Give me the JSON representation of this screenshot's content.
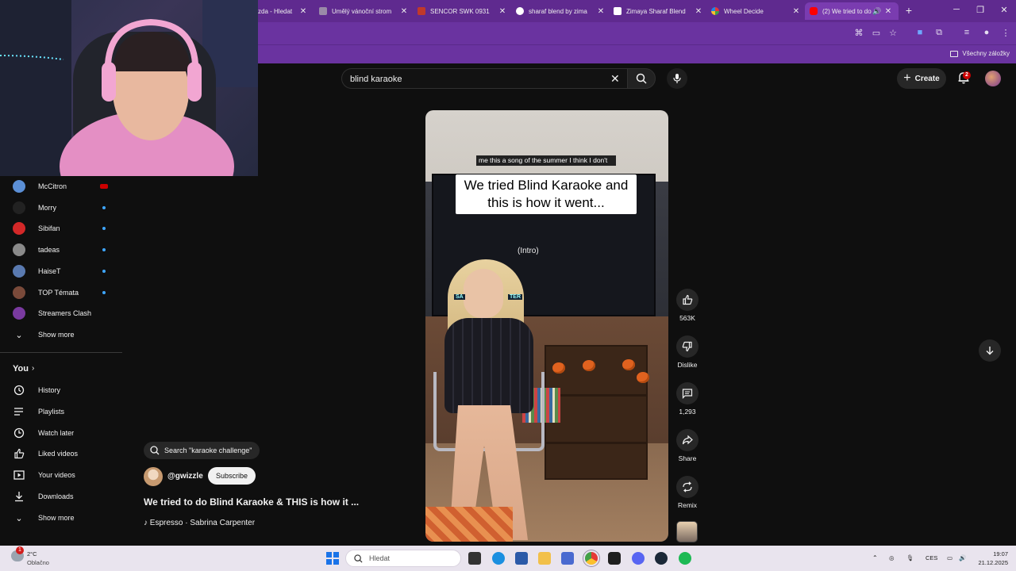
{
  "browser": {
    "tabs": [
      {
        "label": "zda - Hledat ",
        "icon": "search-icon"
      },
      {
        "label": "Umělý vánoční strom",
        "icon": "shop-icon"
      },
      {
        "label": "SENCOR SWK 0931",
        "icon": "shop-icon"
      },
      {
        "label": "sharaf blend by zima",
        "icon": "google-icon"
      },
      {
        "label": "Zimaya Sharaf Blend",
        "icon": "u-icon"
      },
      {
        "label": "Wheel Decide",
        "icon": "wheel-icon"
      },
      {
        "label": "(2) We tried to do",
        "icon": "youtube-icon",
        "active": true
      }
    ],
    "bookmarks_label": "Všechny záložky"
  },
  "youtube": {
    "search_query": "blind karaoke",
    "create_label": "Create",
    "notification_count": "2",
    "subscriptions": [
      {
        "name": "McCitron",
        "live": true,
        "color": "#5b8fd6"
      },
      {
        "name": "Morry",
        "new": true,
        "color": "#222222"
      },
      {
        "name": "Sibifan",
        "new": true,
        "color": "#d32828"
      },
      {
        "name": "tadeas",
        "new": true,
        "color": "#8a8a8a"
      },
      {
        "name": "HaiseT",
        "new": true,
        "color": "#5a7ab0"
      },
      {
        "name": "TOP Témata",
        "new": true,
        "color": "#7a4a3a"
      },
      {
        "name": "Streamers Clash",
        "new": false,
        "color": "#7a3aa0"
      }
    ],
    "subs_show_more": "Show more",
    "you_heading": "You",
    "you_items": [
      {
        "label": "History",
        "icon": "history-icon"
      },
      {
        "label": "Playlists",
        "icon": "playlists-icon"
      },
      {
        "label": "Watch later",
        "icon": "watch-later-icon"
      },
      {
        "label": "Liked videos",
        "icon": "like-icon"
      },
      {
        "label": "Your videos",
        "icon": "your-videos-icon"
      },
      {
        "label": "Downloads",
        "icon": "download-icon"
      },
      {
        "label": "Show more",
        "icon": "chevron-down-icon"
      }
    ],
    "short": {
      "caption_small": "me this a song of the summer I think I don't",
      "caption_big": "We tried Blind Karaoke and this is how it went...",
      "lyric_tag": "(Intro)",
      "sign_text_left": "SA",
      "sign_text_right": "TER",
      "search_suggestion": "Search \"karaoke challenge\"",
      "channel": "@gwizzle",
      "subscribe_label": "Subscribe",
      "title": "We tried to do Blind Karaoke & THIS is how it ...",
      "music": "Espresso · Sabrina Carpenter"
    },
    "actions": {
      "likes": "563K",
      "dislike_label": "Dislike",
      "comments": "1,293",
      "share_label": "Share",
      "remix_label": "Remix"
    }
  },
  "taskbar": {
    "weather_temp": "2°C",
    "weather_status": "Oblačno",
    "weather_badge": "1",
    "search_placeholder": "Hledat",
    "language": "CES",
    "time": "19:07",
    "date": "21.12.2025"
  }
}
